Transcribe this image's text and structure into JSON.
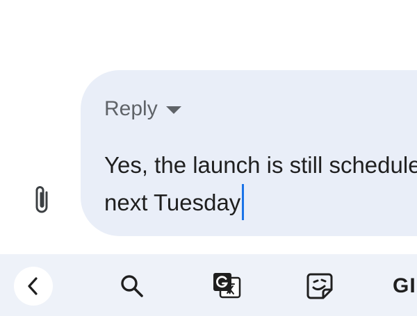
{
  "compose": {
    "mode_label": "Reply",
    "message_lines": [
      "Yes, the launch is still scheduled for",
      "next Tuesday"
    ]
  },
  "keyboard_toolbar": {
    "items": [
      {
        "icon": "chevron-left-icon"
      },
      {
        "icon": "search-icon"
      },
      {
        "icon": "translate-icon"
      },
      {
        "icon": "sticker-icon"
      },
      {
        "icon": "gif-icon",
        "label": "GIF"
      }
    ]
  },
  "colors": {
    "bubble_background": "#e9eef8",
    "toolbar_background": "#eef2f9",
    "cursor": "#1a73e8",
    "secondary_text": "#5f6368",
    "primary_text": "#1f1f1f"
  }
}
